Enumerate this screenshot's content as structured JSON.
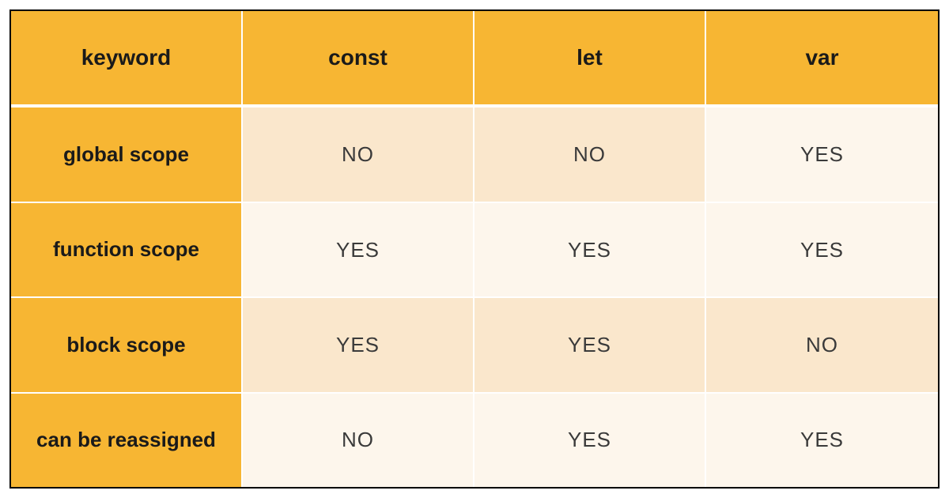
{
  "chart_data": {
    "type": "table",
    "columns": [
      "keyword",
      "const",
      "let",
      "var"
    ],
    "rows": [
      {
        "label": "global scope",
        "values": [
          "NO",
          "NO",
          "YES"
        ]
      },
      {
        "label": "function scope",
        "values": [
          "YES",
          "YES",
          "YES"
        ]
      },
      {
        "label": "block scope",
        "values": [
          "YES",
          "YES",
          "NO"
        ]
      },
      {
        "label": "can be reassigned",
        "values": [
          "NO",
          "YES",
          "YES"
        ]
      }
    ]
  },
  "headers": {
    "col0": "keyword",
    "col1": "const",
    "col2": "let",
    "col3": "var"
  },
  "rows": {
    "r0": {
      "label": "global scope",
      "c1": "NO",
      "c2": "NO",
      "c3": "YES"
    },
    "r1": {
      "label": "function scope",
      "c1": "YES",
      "c2": "YES",
      "c3": "YES"
    },
    "r2": {
      "label": "block scope",
      "c1": "YES",
      "c2": "YES",
      "c3": "NO"
    },
    "r3": {
      "label": "can be reassigned",
      "c1": "NO",
      "c2": "YES",
      "c3": "YES"
    }
  }
}
